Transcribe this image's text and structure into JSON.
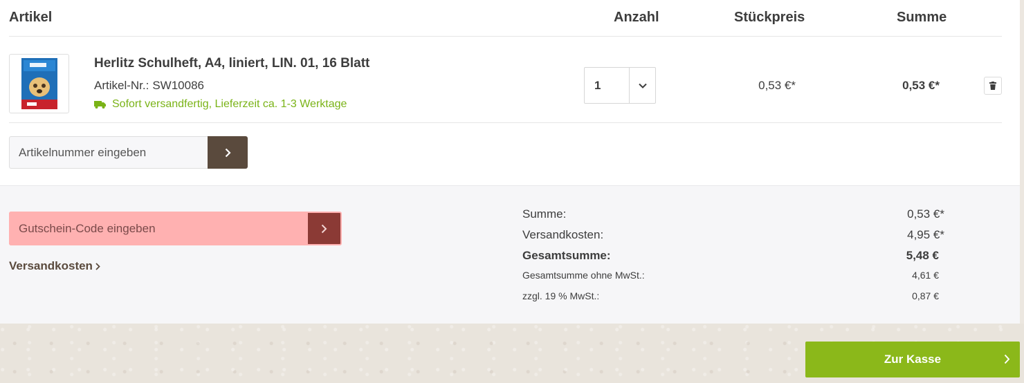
{
  "table_header": {
    "article": "Artikel",
    "quantity": "Anzahl",
    "unit_price": "Stückpreis",
    "sum": "Summe"
  },
  "line_item": {
    "name": "Herlitz Schulheft, A4, liniert, LIN. 01, 16 Blatt",
    "article_number_label": "Artikel-Nr.:",
    "article_number": "SW10086",
    "delivery_status": "Sofort versandfertig, Lieferzeit ca. 1-3 Werktage",
    "quantity": "1",
    "unit_price": "0,53 €*",
    "line_total": "0,53 €*"
  },
  "add_article": {
    "placeholder": "Artikelnummer eingeben"
  },
  "voucher": {
    "placeholder": "Gutschein-Code eingeben"
  },
  "shipping_link": "Versandkosten",
  "totals": {
    "subtotal_label": "Summe:",
    "subtotal_value": "0,53 €*",
    "shipping_label": "Versandkosten:",
    "shipping_value": "4,95 €*",
    "grand_total_label": "Gesamtsumme:",
    "grand_total_value": "5,48 €",
    "net_label": "Gesamtsumme ohne MwSt.:",
    "net_value": "4,61 €",
    "vat_label": "zzgl. 19 % MwSt.:",
    "vat_value": "0,87 €"
  },
  "checkout_label": "Zur Kasse",
  "colors": {
    "accent_green": "#8bb81a",
    "delivery_green": "#7ab317",
    "brown_button": "#5a4a3d",
    "voucher_highlight": "#ffb1b1"
  }
}
